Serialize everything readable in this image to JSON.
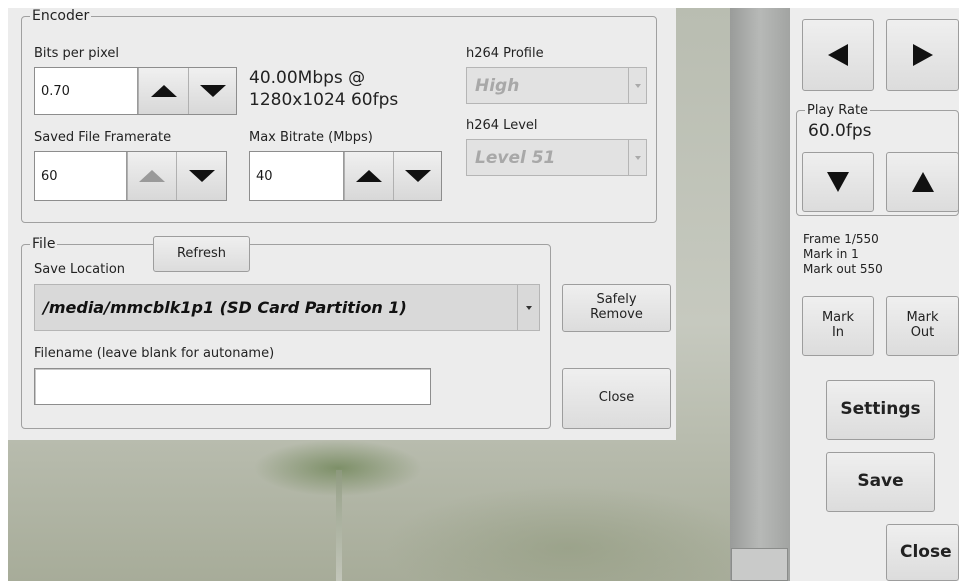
{
  "encoder": {
    "legend": "Encoder",
    "bpp": {
      "label": "Bits per pixel",
      "value": "0.70"
    },
    "bitrate_info_line1": "40.00Mbps @",
    "bitrate_info_line2": "1280x1024 60fps",
    "framerate": {
      "label": "Saved File Framerate",
      "value": "60"
    },
    "max_bitrate": {
      "label": "Max Bitrate (Mbps)",
      "value": "40"
    },
    "profile": {
      "label": "h264 Profile",
      "value": "High"
    },
    "level": {
      "label": "h264 Level",
      "value": "Level 51"
    }
  },
  "file": {
    "legend": "File",
    "refresh_label": "Refresh",
    "save_location_label": "Save Location",
    "save_location_value": "/media/mmcblk1p1 (SD Card Partition 1)",
    "safely_remove_line1": "Safely",
    "safely_remove_line2": "Remove",
    "filename_label": "Filename (leave blank for autoname)",
    "filename_value": "",
    "close_label": "Close"
  },
  "playback": {
    "play_rate_legend": "Play Rate",
    "play_rate_value": "60.0fps",
    "frame_info": "Frame 1/550",
    "mark_in_info": "Mark in 1",
    "mark_out_info": "Mark out 550",
    "mark_in_line1": "Mark",
    "mark_in_line2": "In",
    "mark_out_line1": "Mark",
    "mark_out_line2": "Out",
    "settings_label": "Settings",
    "save_label": "Save",
    "close_label": "Close"
  }
}
